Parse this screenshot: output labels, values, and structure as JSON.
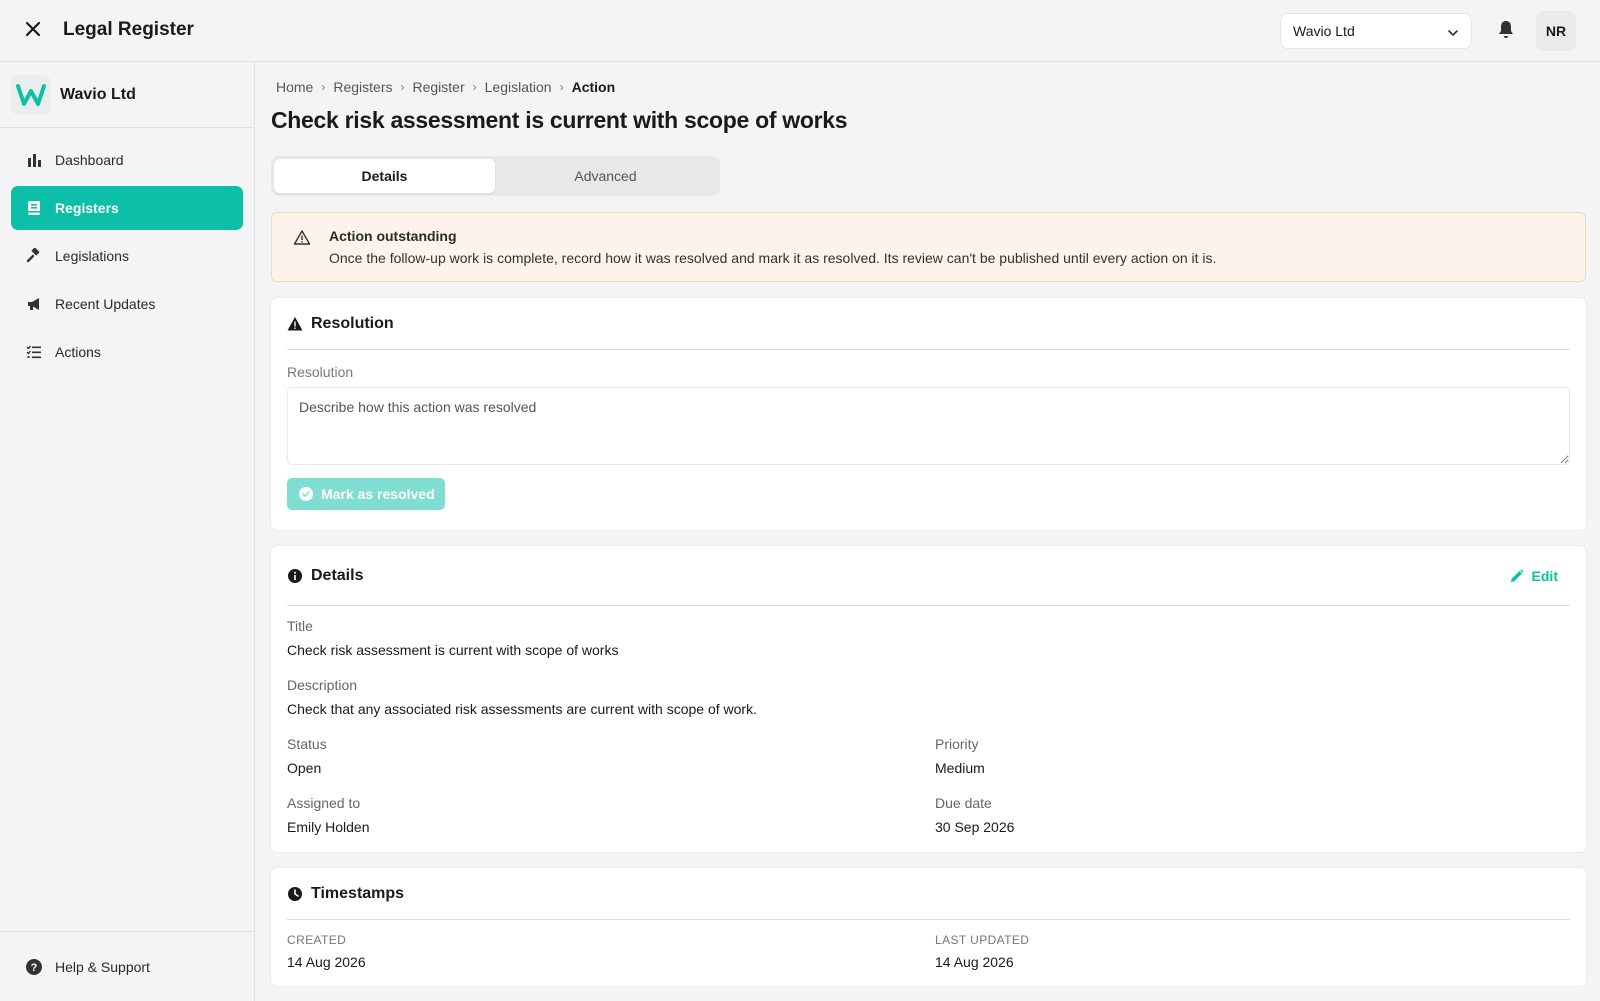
{
  "header": {
    "app_title": "Legal Register",
    "org_selector": "Wavio Ltd",
    "avatar_initials": "NR"
  },
  "sidebar": {
    "org_name": "Wavio Ltd",
    "items": [
      {
        "label": "Dashboard",
        "icon": "bar-chart-icon"
      },
      {
        "label": "Registers",
        "icon": "book-icon"
      },
      {
        "label": "Legislations",
        "icon": "gavel-icon"
      },
      {
        "label": "Recent Updates",
        "icon": "megaphone-icon"
      },
      {
        "label": "Actions",
        "icon": "checklist-icon"
      }
    ],
    "help_label": "Help & Support"
  },
  "breadcrumb": [
    "Home",
    "Registers",
    "Register",
    "Legislation",
    "Action"
  ],
  "page_title": "Check risk assessment is current with scope of works",
  "tabs": [
    "Details",
    "Advanced"
  ],
  "alert": {
    "title": "Action outstanding",
    "message": "Once the follow-up work is complete, record how it was resolved and mark it as resolved. Its review can't be published until every action on it is."
  },
  "resolution": {
    "title": "Resolution",
    "field_label": "Resolution",
    "placeholder": "Describe how this action was resolved",
    "button_label": "Mark as resolved"
  },
  "details": {
    "title": "Details",
    "edit_label": "Edit",
    "title_label": "Title",
    "title_value": "Check risk assessment is current with scope of works",
    "description_label": "Description",
    "description_value": "Check that any associated risk assessments are current with scope of work.",
    "status_label": "Status",
    "status_value": "Open",
    "priority_label": "Priority",
    "priority_value": "Medium",
    "assigned_label": "Assigned to",
    "assigned_value": "Emily Holden",
    "due_label": "Due date",
    "due_value": "30 Sep 2026"
  },
  "timestamps": {
    "title": "Timestamps",
    "created_label": "CREATED",
    "created_value": "14 Aug 2026",
    "updated_label": "LAST UPDATED",
    "updated_value": "14 Aug 2026"
  },
  "colors": {
    "accent": "#0ebfa8",
    "accent_disabled": "#7fddd1",
    "alert_bg": "#fbf3ec",
    "alert_border": "#efd8c2"
  }
}
